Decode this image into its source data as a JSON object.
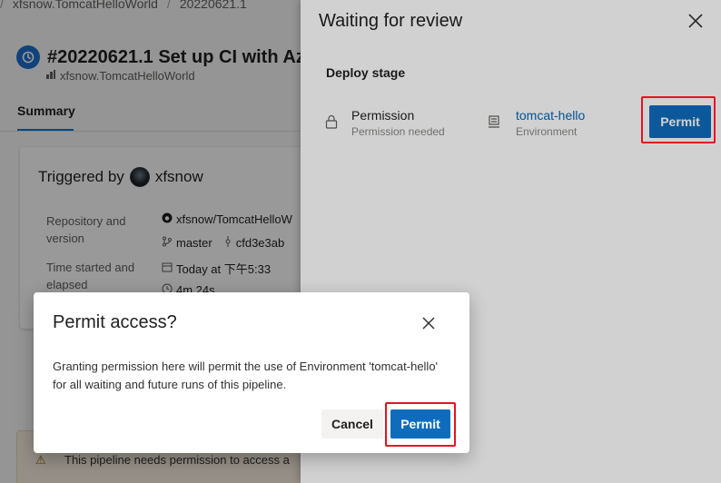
{
  "background": {
    "breadcrumbs": [
      "xfsnow.TomcatHelloWorld",
      "20220621.1"
    ],
    "run_title": "#20220621.1 Set up CI with Azu",
    "run_subtitle": "xfsnow.TomcatHelloWorld",
    "tab_summary": "Summary",
    "triggered_by_label": "Triggered by",
    "triggered_by_user": "xfsnow",
    "repo_label": "Repository and version",
    "repo_value": "xfsnow/TomcatHelloW",
    "branch": "master",
    "commit": "cfd3e3ab",
    "time_label": "Time started and elapsed",
    "time_started": "Today at 下午5:33",
    "elapsed": "4m 24s",
    "warning_text": "This pipeline needs permission to access a"
  },
  "panel": {
    "title": "Waiting for review",
    "section_title": "Deploy stage",
    "permission_title": "Permission",
    "permission_subtitle": "Permission needed",
    "environment_name": "tomcat-hello",
    "environment_type": "Environment",
    "permit_label": "Permit"
  },
  "dialog": {
    "title": "Permit access?",
    "body": "Granting permission here will permit the use of Environment 'tomcat-hello' for all waiting and future runs of this pipeline.",
    "cancel_label": "Cancel",
    "permit_label": "Permit"
  },
  "colors": {
    "primary": "#0f6cbd",
    "highlight": "#e81123",
    "link": "#0066b8"
  }
}
